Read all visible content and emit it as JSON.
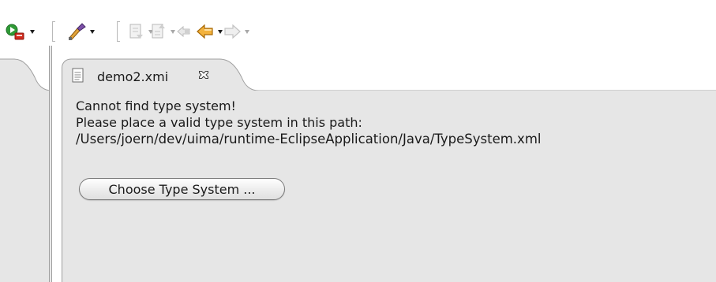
{
  "toolbar": {
    "items": [
      {
        "icon": "run-icon",
        "has_dropdown": true
      },
      {
        "icon": "external-tools-icon",
        "has_dropdown": true
      },
      {
        "icon": "next-annotation-icon",
        "has_dropdown": true,
        "disabled": true
      },
      {
        "icon": "previous-annotation-icon",
        "has_dropdown": true,
        "disabled": true
      },
      {
        "icon": "last-edit-location-icon",
        "disabled": true
      },
      {
        "icon": "back-icon",
        "has_dropdown": true
      },
      {
        "icon": "forward-icon",
        "has_dropdown": true,
        "disabled": true
      }
    ]
  },
  "editor": {
    "tab": {
      "title": "demo2.xmi",
      "icon": "file-document-icon",
      "close_icon": "close-icon"
    },
    "message": {
      "line1": "Cannot find type system!",
      "line2": "Please place a valid type system in this path:",
      "path": "/Users/joern/dev/uima/runtime-EclipseApplication/Java/TypeSystem.xml"
    },
    "choose_button_label": "Choose Type System ..."
  },
  "colors": {
    "body_bg": "#e6e6e6",
    "border": "#9f9f9f",
    "run_green": "#2f9a36",
    "run_red": "#d22a1d",
    "nav_orange": "#e89a1e"
  }
}
